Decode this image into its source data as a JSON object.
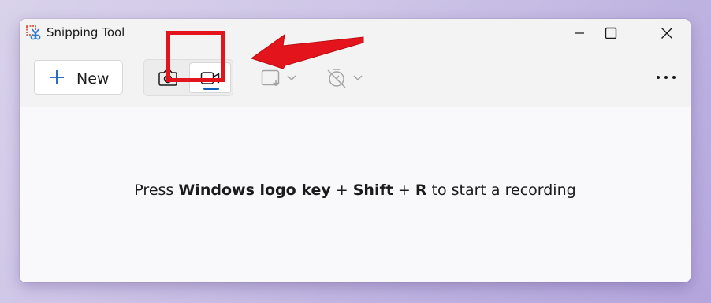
{
  "window": {
    "title": "Snipping Tool"
  },
  "toolbar": {
    "new_label": "New",
    "modes": [
      {
        "name": "snip",
        "icon": "camera-icon",
        "active": false
      },
      {
        "name": "record",
        "icon": "video-camera-icon",
        "active": true
      }
    ],
    "snip_shape_icon": "rectangle-snip-icon",
    "delay_icon": "timer-off-icon",
    "more_icon": "more-icon"
  },
  "content": {
    "hint_prefix": "Press",
    "hint_key1": "Windows logo key",
    "hint_plus1": "+",
    "hint_key2": "Shift",
    "hint_plus2": "+",
    "hint_key3": "R",
    "hint_suffix": "to start a recording"
  },
  "annotation": {
    "highlight_color": "#e3141b",
    "indicator_color": "#1060bd"
  }
}
